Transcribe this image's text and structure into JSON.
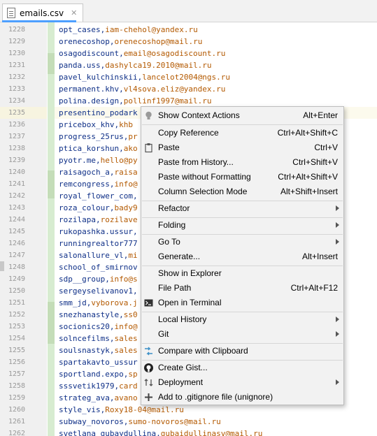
{
  "tab": {
    "filename": "emails.csv",
    "close_glyph": "✕"
  },
  "lines": [
    {
      "num": "1228",
      "a": "opt_cases,",
      "b": "iam-chehol@yandex.ru"
    },
    {
      "num": "1229",
      "a": "orenecoshop,",
      "b": "orenecoshop@mail.ru"
    },
    {
      "num": "1230",
      "a": "osagodiscount,",
      "b": "email@osagodiscount.ru"
    },
    {
      "num": "1231",
      "a": "panda.uss,",
      "b": "dashylca19.2010@mail.ru"
    },
    {
      "num": "1232",
      "a": "pavel_kulchinskii,",
      "b": "lancelot2004@ngs.ru"
    },
    {
      "num": "1233",
      "a": "permanent.khv,",
      "b": "vl4sova.eliz@yandex.ru"
    },
    {
      "num": "1234",
      "a": "polina.design,",
      "b": "pollinf1997@mail.ru"
    },
    {
      "num": "1235",
      "a": "presentino_podark",
      "b": ""
    },
    {
      "num": "1236",
      "a": "pricebox_khv,",
      "b": "khb"
    },
    {
      "num": "1237",
      "a": "progress_25rus,",
      "b": "pr"
    },
    {
      "num": "1238",
      "a": "ptica_korshun,",
      "b": "ako"
    },
    {
      "num": "1239",
      "a": "pyotr.me,",
      "b": "hello@py"
    },
    {
      "num": "1240",
      "a": "raisagoch_a,",
      "b": "raisa"
    },
    {
      "num": "1241",
      "a": "remcongress,",
      "b": "info@"
    },
    {
      "num": "1242",
      "a": "royal_flower_com,",
      "b": ""
    },
    {
      "num": "1243",
      "a": "roza_colour,",
      "b": "bady9"
    },
    {
      "num": "1244",
      "a": "rozilapa,",
      "b": "rozilave"
    },
    {
      "num": "1245",
      "a": "rukopashka.ussur,",
      "b": ""
    },
    {
      "num": "1246",
      "a": "runningrealtor777",
      "b": ""
    },
    {
      "num": "1247",
      "a": "salonallure_vl,",
      "b": "mi"
    },
    {
      "num": "1248",
      "a": "school_of_smirnov",
      "b": ""
    },
    {
      "num": "1249",
      "a": "sdp__group,",
      "b": "info@s"
    },
    {
      "num": "1250",
      "a": "sergeyselivanov1,",
      "b": ""
    },
    {
      "num": "1251",
      "a": "smm_jd,",
      "b": "vyborova.j"
    },
    {
      "num": "1252",
      "a": "snezhanastyle,",
      "b": "ss0"
    },
    {
      "num": "1253",
      "a": "socionics20,",
      "b": "info@"
    },
    {
      "num": "1254",
      "a": "solncefilms,",
      "b": "sales"
    },
    {
      "num": "1255",
      "a": "soulsnastyk,",
      "b": "sales"
    },
    {
      "num": "1256",
      "a": "spartakavto_ussur",
      "b": ""
    },
    {
      "num": "1257",
      "a": "sportland.expo,",
      "b": "sp"
    },
    {
      "num": "1258",
      "a": "sssvetik1979,",
      "b": "card"
    },
    {
      "num": "1259",
      "a": "strateg_ava,",
      "b": "avano"
    },
    {
      "num": "1260",
      "a": "style_vis,",
      "b": "Roxy18-04@mail.ru"
    },
    {
      "num": "1261",
      "a": "subway_novoros,",
      "b": "sumo-novoros@mail.ru"
    },
    {
      "num": "1262",
      "a": "svetlana_gubaydullina,",
      "b": "gubaidullinasv@mail.ru"
    }
  ],
  "menu": {
    "show_context_actions": {
      "label": "Show Context Actions",
      "shortcut": "Alt+Enter",
      "icon": "lightbulb-icon"
    },
    "copy_reference": {
      "label": "Copy Reference",
      "shortcut": "Ctrl+Alt+Shift+C"
    },
    "paste": {
      "label": "Paste",
      "shortcut": "Ctrl+V",
      "icon": "clipboard-icon"
    },
    "paste_from_history": {
      "label": "Paste from History...",
      "shortcut": "Ctrl+Shift+V"
    },
    "paste_without_formatting": {
      "label": "Paste without Formatting",
      "shortcut": "Ctrl+Alt+Shift+V"
    },
    "column_selection_mode": {
      "label": "Column Selection Mode",
      "shortcut": "Alt+Shift+Insert"
    },
    "refactor": {
      "label": "Refactor"
    },
    "folding": {
      "label": "Folding"
    },
    "go_to": {
      "label": "Go To"
    },
    "generate": {
      "label": "Generate...",
      "shortcut": "Alt+Insert"
    },
    "show_in_explorer": {
      "label": "Show in Explorer"
    },
    "file_path": {
      "label": "File Path",
      "shortcut": "Ctrl+Alt+F12"
    },
    "open_in_terminal": {
      "label": "Open in Terminal",
      "icon": "terminal-icon"
    },
    "local_history": {
      "label": "Local History"
    },
    "git": {
      "label": "Git"
    },
    "compare_with_clipboard": {
      "label": "Compare with Clipboard",
      "icon": "compare-icon"
    },
    "create_gist": {
      "label": "Create Gist...",
      "icon": "github-icon"
    },
    "deployment": {
      "label": "Deployment",
      "icon": "deployment-icon"
    },
    "add_to_gitignore": {
      "label": "Add to .gitignore file (unignore)",
      "icon": "add-icon"
    }
  },
  "colors": {
    "key": "#0e2f87",
    "value": "#b35900",
    "change_stripe": "#d7ecd0",
    "menu_bg": "#f2f2f2"
  }
}
